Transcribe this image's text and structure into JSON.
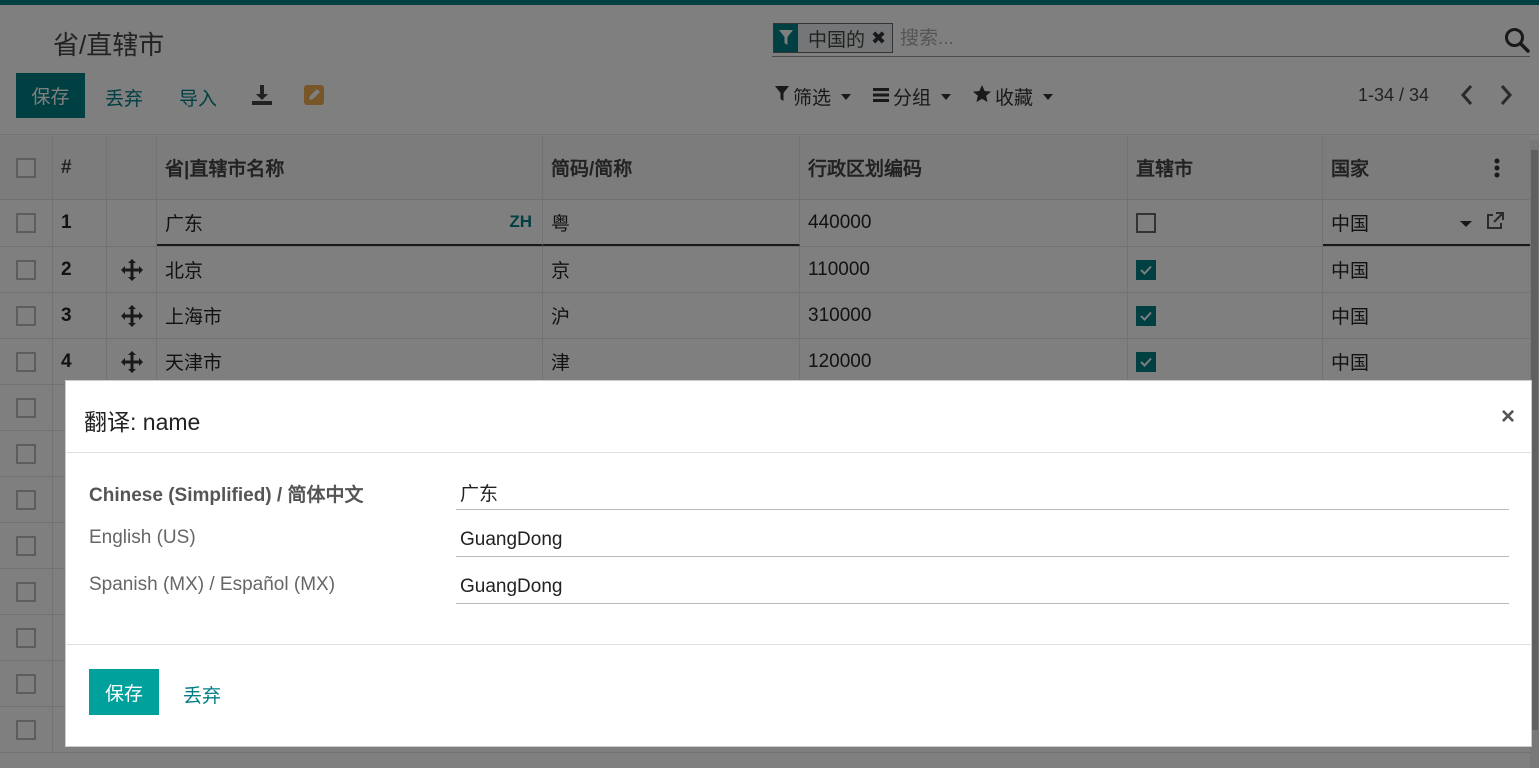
{
  "page": {
    "title": "省/直辖市"
  },
  "search": {
    "facet_label": "中国的",
    "placeholder": "搜索..."
  },
  "toolbar": {
    "save_label": "保存",
    "discard_label": "丢弃",
    "import_label": "导入"
  },
  "filters": {
    "filter_label": "筛选",
    "group_label": "分组",
    "favorites_label": "收藏"
  },
  "pager": {
    "text": "1-34 / 34"
  },
  "table": {
    "headers": {
      "num": "#",
      "name": "省|直辖市名称",
      "code": "简码/简称",
      "admin": "行政区划编码",
      "muni": "直辖市",
      "country": "国家"
    },
    "rows": [
      {
        "num": "1",
        "name": "广东",
        "lang": "ZH",
        "code": "粤",
        "admin": "440000",
        "muni": false,
        "country": "中国"
      },
      {
        "num": "2",
        "name": "北京",
        "code": "京",
        "admin": "110000",
        "muni": true,
        "country": "中国"
      },
      {
        "num": "3",
        "name": "上海市",
        "code": "沪",
        "admin": "310000",
        "muni": true,
        "country": "中国"
      },
      {
        "num": "4",
        "name": "天津市",
        "code": "津",
        "admin": "120000",
        "muni": true,
        "country": "中国"
      }
    ]
  },
  "dialog": {
    "title": "翻译: name",
    "translations": [
      {
        "lang": "Chinese (Simplified) / 简体中文",
        "value": "广东"
      },
      {
        "lang": "English (US)",
        "value": "GuangDong"
      },
      {
        "lang": "Spanish (MX) / Español (MX)",
        "value": "GuangDong"
      }
    ],
    "save_label": "保存",
    "discard_label": "丢弃"
  },
  "colors": {
    "primary": "#017e84",
    "dialog_primary": "#00a09d"
  }
}
